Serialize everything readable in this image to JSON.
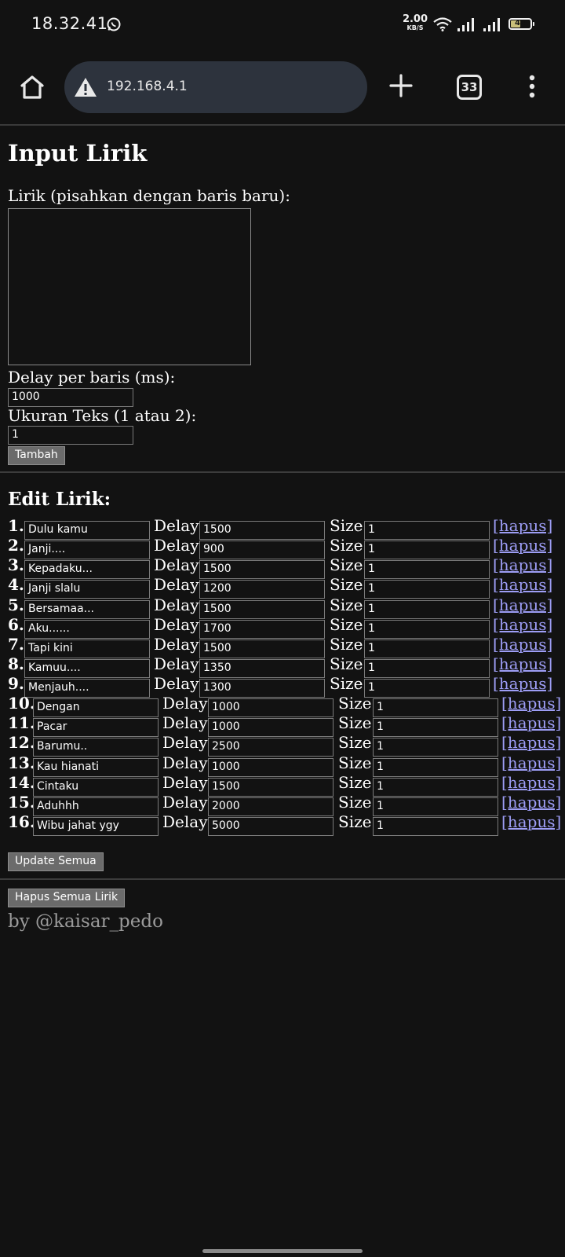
{
  "status_bar": {
    "time": "18.32.41",
    "net_speed": "2.00",
    "net_unit": "KB/S",
    "battery": "48"
  },
  "browser": {
    "url": "192.168.4.1",
    "tab_count": "33"
  },
  "form": {
    "title": "Input Lirik",
    "lyrics_label": "Lirik (pisahkan dengan baris baru):",
    "delay_label": "Delay per baris (ms):",
    "delay_value": "1000",
    "size_label": "Ukuran Teks (1 atau 2):",
    "size_value": "1",
    "add_button": "Tambah"
  },
  "edit": {
    "title": "Edit Lirik:",
    "delay_label": "Delay:",
    "size_label": "Size:",
    "delete_link": "[hapus]",
    "rows": [
      {
        "num": "1.",
        "text": "Dulu kamu",
        "delay": "1500",
        "size": "1"
      },
      {
        "num": "2.",
        "text": "Janji....",
        "delay": "900",
        "size": "1"
      },
      {
        "num": "3.",
        "text": "Kepadaku...",
        "delay": "1500",
        "size": "1"
      },
      {
        "num": "4.",
        "text": "Janji slalu",
        "delay": "1200",
        "size": "1"
      },
      {
        "num": "5.",
        "text": "Bersamaa...",
        "delay": "1500",
        "size": "1"
      },
      {
        "num": "6.",
        "text": "Aku......",
        "delay": "1700",
        "size": "1"
      },
      {
        "num": "7.",
        "text": "Tapi kini",
        "delay": "1500",
        "size": "1"
      },
      {
        "num": "8.",
        "text": "Kamuu....",
        "delay": "1350",
        "size": "1"
      },
      {
        "num": "9.",
        "text": "Menjauh....",
        "delay": "1300",
        "size": "1"
      },
      {
        "num": "10.",
        "text": "Dengan",
        "delay": "1000",
        "size": "1"
      },
      {
        "num": "11.",
        "text": "Pacar",
        "delay": "1000",
        "size": "1"
      },
      {
        "num": "12.",
        "text": "Barumu..",
        "delay": "2500",
        "size": "1"
      },
      {
        "num": "13.",
        "text": "Kau hianati",
        "delay": "1000",
        "size": "1"
      },
      {
        "num": "14.",
        "text": "Cintaku",
        "delay": "1500",
        "size": "1"
      },
      {
        "num": "15.",
        "text": "Aduhhh",
        "delay": "2000",
        "size": "1"
      },
      {
        "num": "16.",
        "text": "Wibu jahat ygy",
        "delay": "5000",
        "size": "1"
      }
    ],
    "update_button": "Update Semua"
  },
  "delete_all_button": "Hapus Semua Lirik",
  "credit": "by @kaisar_pedo"
}
